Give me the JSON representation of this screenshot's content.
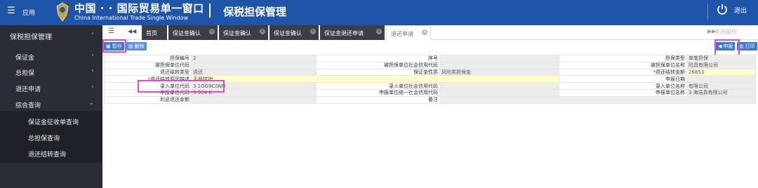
{
  "header": {
    "menu_label": "应用",
    "brand_cn": "中国 · · 国际贸易单一窗口",
    "brand_en": "China International Trade Single Window",
    "module_title": "保税担保管理",
    "logout_label": "退出",
    "colors": {
      "header_bg": "#1f55a8",
      "sidebar_bg": "#2a2d36",
      "highlight": "#d84fc9",
      "button": "#3a7ad0"
    }
  },
  "sidebar": {
    "title": "保税担保管理",
    "items": [
      {
        "label": "保证金"
      },
      {
        "label": "总担保"
      },
      {
        "label": "退还申请"
      },
      {
        "label": "综合查询"
      }
    ],
    "sub_items": [
      {
        "label": "保证金征收单查询"
      },
      {
        "label": "总担保查询"
      },
      {
        "label": "退还结转查询"
      }
    ]
  },
  "tabs": {
    "items": [
      {
        "label": "首页"
      },
      {
        "label": "保证金确认"
      },
      {
        "label": "保证金确认"
      },
      {
        "label": "保证金确认"
      },
      {
        "label": "保证金退还申请"
      },
      {
        "label": "退还申请"
      }
    ],
    "close_ops_label": "关闭操作"
  },
  "toolbar": {
    "save_label": "暂存",
    "delete_label": "删除",
    "declare_label": "申报",
    "print_label": "打印"
  },
  "form": {
    "rows": [
      [
        {
          "k": "担保编号",
          "v": "2"
        },
        {
          "k": "序号",
          "v": ""
        },
        {
          "k": "担保类型",
          "v": "单笔担保"
        }
      ],
      [
        {
          "k": "被担保单位代码",
          "v": ""
        },
        {
          "k": "被担保单位社会信用代码",
          "v": ""
        },
        {
          "k": "被担保单位名称",
          "v": "险具有限公司"
        }
      ],
      [
        {
          "k": "退还结转类型",
          "v": "退还"
        },
        {
          "k": "保证金性质",
          "v": "风险类担保金"
        },
        {
          "k": "退还结转金额",
          "v": "26853"
        }
      ]
    ],
    "reason_label": "退还结转原因描述",
    "reason_value": "手册核销",
    "declare_date_label": "申报日期",
    "declare_date_value": "",
    "rows2": [
      [
        {
          "k": "录入单位代码",
          "v": "3      1GG9C0NN"
        },
        {
          "k": "录入单位社会信用代码",
          "v": ""
        },
        {
          "k": "录入单位名称",
          "v": "有限公司"
        }
      ],
      [
        {
          "k": "申报单位代码",
          "v": "3      964     K"
        },
        {
          "k": "申报单位统一社会信用代码",
          "v": ""
        },
        {
          "k": "申报单位名称",
          "v": "3    海洁具有限公司"
        }
      ]
    ],
    "refund_interest_label": "利息退还金额",
    "refund_interest_value": "",
    "remark_label": "备注",
    "remark_value": ""
  }
}
